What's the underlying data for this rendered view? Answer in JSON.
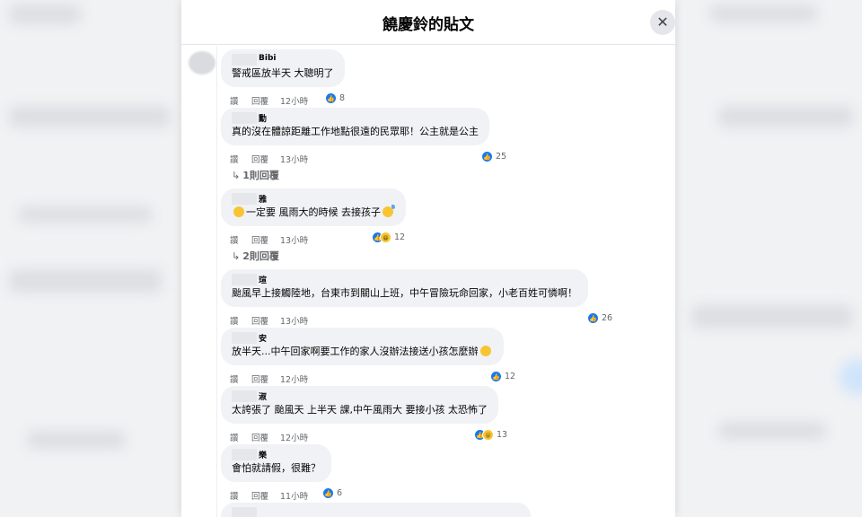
{
  "modal": {
    "title": "饒慶鈴的貼文",
    "close_glyph": "✕"
  },
  "comments": [
    {
      "author": "Bibi",
      "text": "警戒區放半天 大聰明了",
      "like_label": "讚",
      "reply_label": "回覆",
      "time": "12小時",
      "reaction_count": "8",
      "reactions": [
        "like"
      ]
    },
    {
      "author": "勳",
      "text": "真的沒在體諒距離工作地點很遠的民眾耶！公主就是公主",
      "like_label": "讚",
      "reply_label": "回覆",
      "time": "13小時",
      "reaction_count": "25",
      "reactions": [
        "like"
      ],
      "replies_link": "1則回覆"
    },
    {
      "author": "雅",
      "text_before": "一定要 風雨大的時候 去接孩子",
      "like_label": "讚",
      "reply_label": "回覆",
      "time": "13小時",
      "reaction_count": "12",
      "reactions": [
        "like",
        "haha"
      ],
      "replies_link": "2則回覆"
    },
    {
      "author": "瑄",
      "text": "颱風早上接觸陸地，台東市到關山上班，中午冒險玩命回家，小老百姓可憐啊！",
      "like_label": "讚",
      "reply_label": "回覆",
      "time": "13小時",
      "reaction_count": "26",
      "reactions": [
        "like"
      ]
    },
    {
      "author": "安",
      "text": "放半天...中午回家啊要工作的家人沒辦法接送小孩怎麼辦",
      "like_label": "讚",
      "reply_label": "回覆",
      "time": "12小時",
      "reaction_count": "12",
      "reactions": [
        "like"
      ]
    },
    {
      "author": "淑",
      "text": "太誇張了 颱風天 上半天 課,中午風雨大 要接小孩 太恐怖了",
      "like_label": "讚",
      "reply_label": "回覆",
      "time": "12小時",
      "reaction_count": "13",
      "reactions": [
        "like",
        "haha"
      ]
    },
    {
      "author": "樂",
      "text": "會怕就請假，很難？",
      "like_label": "讚",
      "reply_label": "回覆",
      "time": "11小時",
      "reaction_count": "6",
      "reactions": [
        "like"
      ]
    }
  ],
  "colors": {
    "like_blue": "#1877f2",
    "bubble_gray": "#f0f2f5",
    "meta_gray": "#65676b"
  },
  "icons": {
    "close": "close-icon",
    "like": "thumbs-up-icon",
    "haha": "haha-icon",
    "reply_arrow": "reply-arrow-icon"
  }
}
